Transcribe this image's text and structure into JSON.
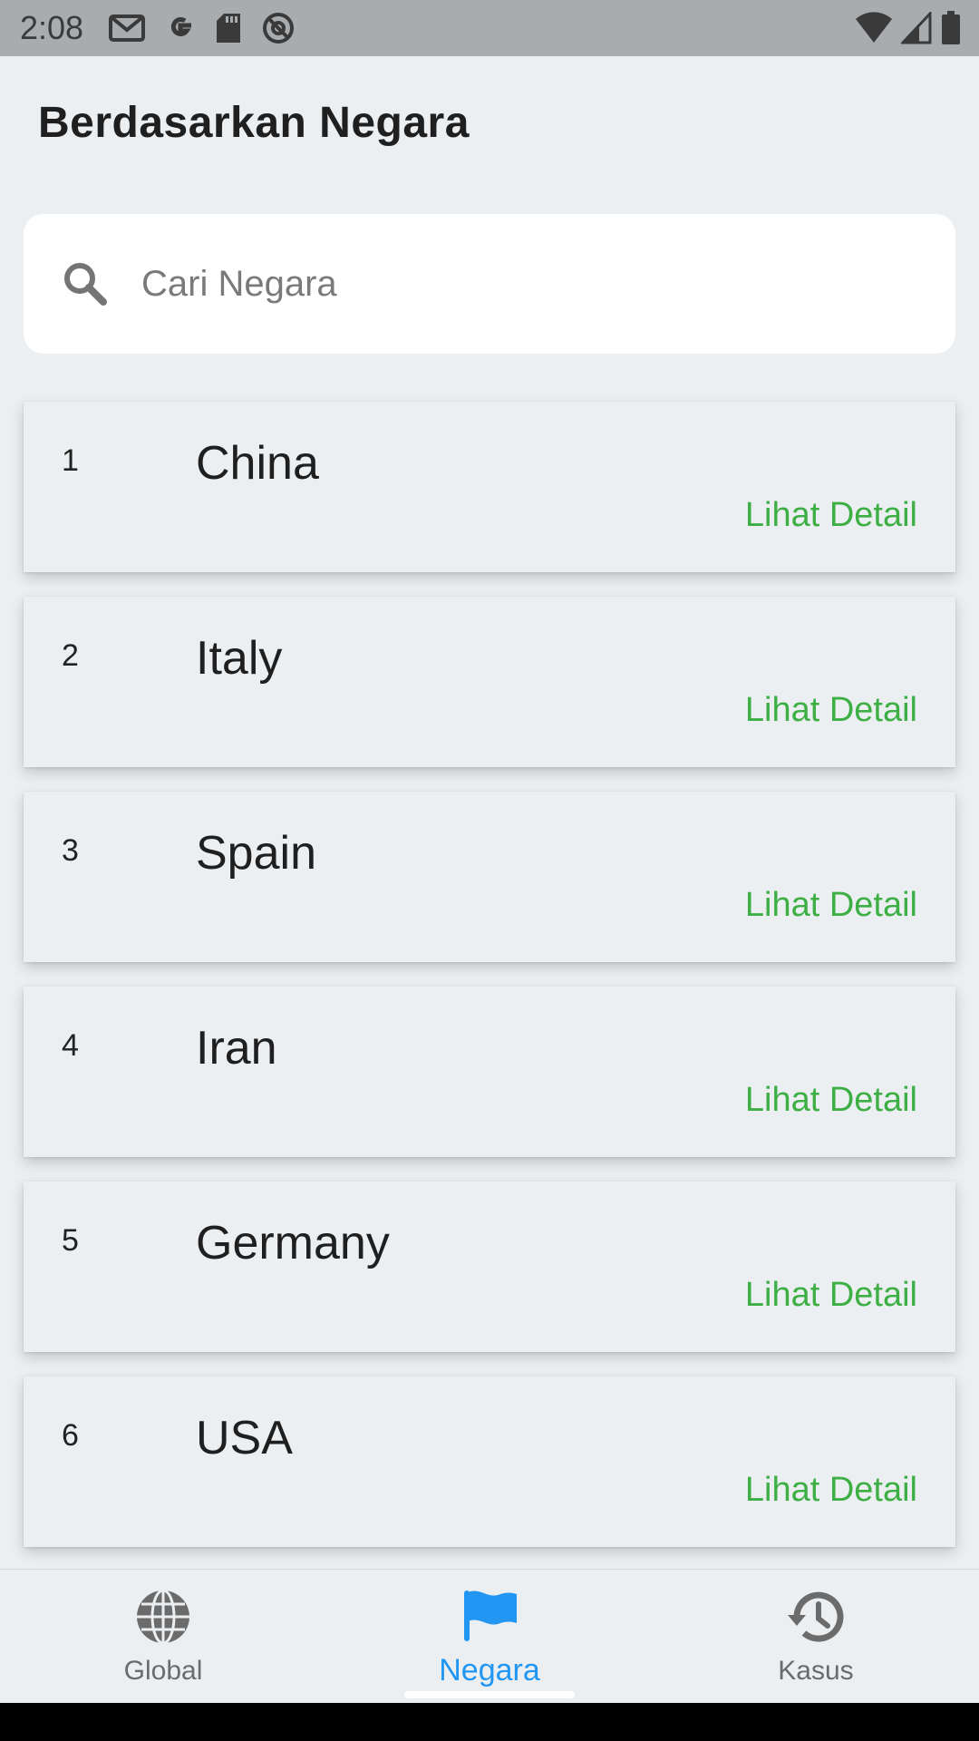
{
  "status_bar": {
    "time": "2:08",
    "left_icons": [
      "gmail-icon",
      "google-icon",
      "sd-card-icon",
      "at-sign-icon"
    ],
    "right_icons": [
      "wifi-icon",
      "signal-icon",
      "battery-icon"
    ]
  },
  "page": {
    "title": "Berdasarkan Negara"
  },
  "search": {
    "placeholder": "Cari Negara",
    "value": ""
  },
  "countries": [
    {
      "rank": "1",
      "name": "China",
      "link": "Lihat Detail"
    },
    {
      "rank": "2",
      "name": "Italy",
      "link": "Lihat Detail"
    },
    {
      "rank": "3",
      "name": "Spain",
      "link": "Lihat Detail"
    },
    {
      "rank": "4",
      "name": "Iran",
      "link": "Lihat Detail"
    },
    {
      "rank": "5",
      "name": "Germany",
      "link": "Lihat Detail"
    },
    {
      "rank": "6",
      "name": "USA",
      "link": "Lihat Detail"
    }
  ],
  "bottom_nav": {
    "items": [
      {
        "label": "Global",
        "icon": "globe-icon",
        "active": false
      },
      {
        "label": "Negara",
        "icon": "flag-icon",
        "active": true
      },
      {
        "label": "Kasus",
        "icon": "history-icon",
        "active": false
      }
    ]
  },
  "colors": {
    "accent": "#2196f3",
    "link": "#3daf45",
    "background": "#eceff2",
    "status_bar": "#a9acaf"
  }
}
